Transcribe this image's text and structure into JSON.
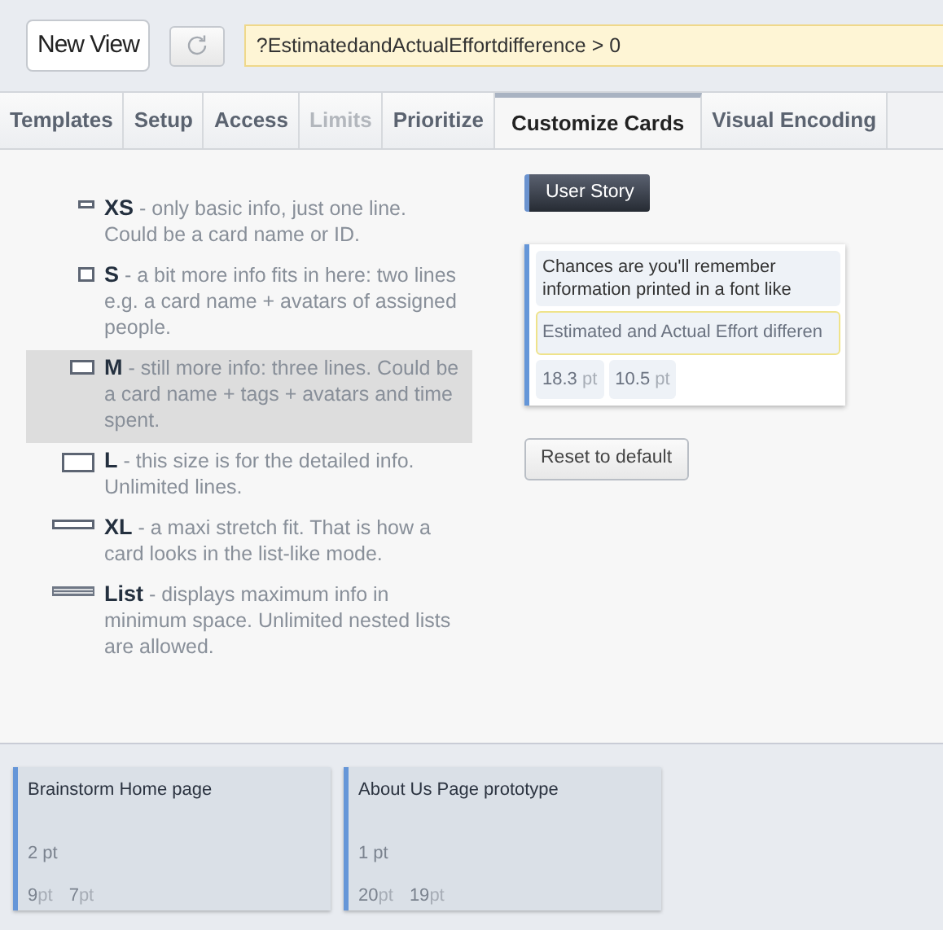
{
  "toolbar": {
    "view_button": "New View",
    "query": "?EstimatedandActualEffortdifference > 0"
  },
  "tabs": [
    {
      "label": "Templates",
      "selected": false,
      "disabled": false
    },
    {
      "label": "Setup",
      "selected": false,
      "disabled": false
    },
    {
      "label": "Access",
      "selected": false,
      "disabled": false
    },
    {
      "label": "Limits",
      "selected": false,
      "disabled": true
    },
    {
      "label": "Prioritize",
      "selected": false,
      "disabled": false
    },
    {
      "label": "Customize Cards",
      "selected": true,
      "disabled": false
    },
    {
      "label": "Visual Encoding",
      "selected": false,
      "disabled": false
    }
  ],
  "sizes": [
    {
      "kind": "xs",
      "name": "XS",
      "text": " - only basic info, just one line. Could be a card name or ID.",
      "selected": false
    },
    {
      "kind": "s",
      "name": "S",
      "text": " - a bit more info fits in here: two lines e.g. a card name + avatars of assigned people.",
      "selected": false
    },
    {
      "kind": "m",
      "name": "M",
      "text": " - still more info: three lines. Could be a card name + tags + avatars and time spent.",
      "selected": true
    },
    {
      "kind": "l",
      "name": "L",
      "text": " - this size is for the detailed info. Unlimited lines.",
      "selected": false
    },
    {
      "kind": "xl",
      "name": "XL",
      "text": " - a maxi stretch fit. That is how a card looks in the list-like mode.",
      "selected": false
    },
    {
      "kind": "list",
      "name": "List",
      "text": " - displays maximum info in minimum space. Unlimited nested lists are allowed.",
      "selected": false
    }
  ],
  "preview": {
    "type_tag": "User Story",
    "sample_text": "Chances are you'll remember information printed in a font like",
    "field": "Estimated and Actual Effort differen",
    "metrics": [
      {
        "value": "18.3",
        "unit": "pt"
      },
      {
        "value": "10.5",
        "unit": "pt"
      }
    ],
    "reset_button": "Reset to default"
  },
  "cards": [
    {
      "title": "Brainstorm Home page",
      "points": "2 pt",
      "metrics": [
        {
          "value": "9",
          "unit": "pt"
        },
        {
          "value": "7",
          "unit": "pt"
        }
      ]
    },
    {
      "title": "About Us Page prototype",
      "points": "1 pt",
      "metrics": [
        {
          "value": "20",
          "unit": "pt"
        },
        {
          "value": "19",
          "unit": "pt"
        }
      ]
    }
  ]
}
